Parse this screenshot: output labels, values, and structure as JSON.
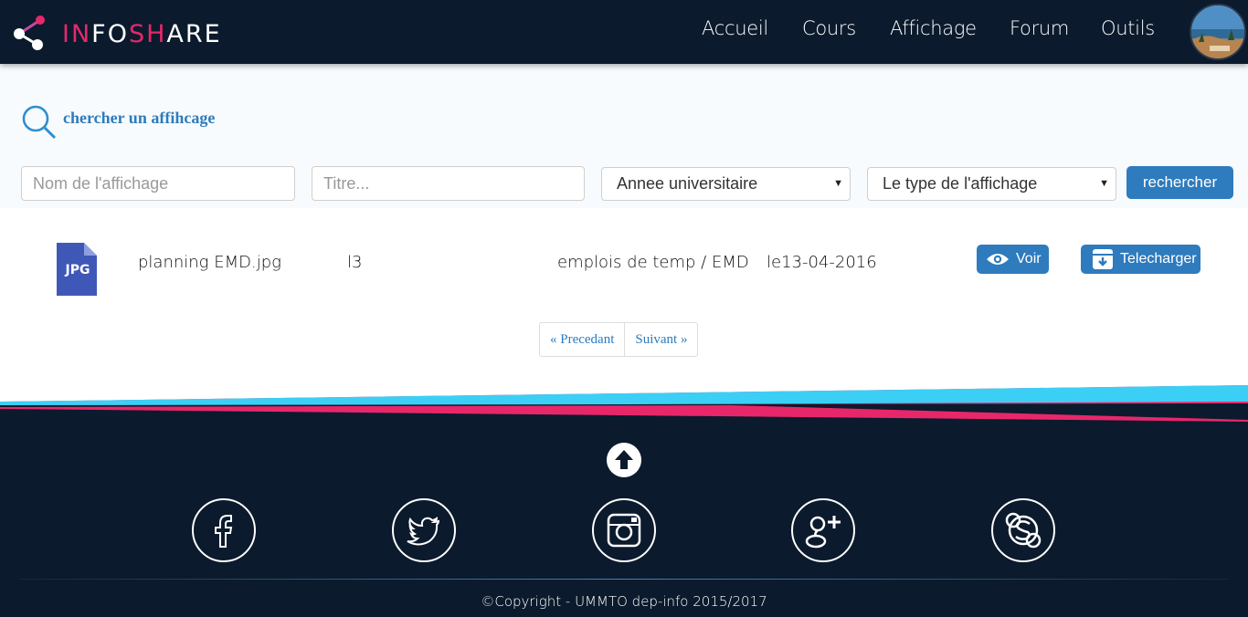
{
  "brand": {
    "prefix": "IN",
    "mid": "FO",
    "sh": "SH",
    "suffix": "ARE"
  },
  "nav": {
    "items": [
      "Accueil",
      "Cours",
      "Affichage",
      "Forum",
      "Outils"
    ]
  },
  "search": {
    "title": "chercher un affihcage",
    "name_placeholder": "Nom de l'affichage",
    "title_placeholder": "Titre...",
    "year_select": "Annee universitaire",
    "type_select": "Le type de l'affichage",
    "button_label": "rechercher"
  },
  "results": [
    {
      "file_type": "JPG",
      "name": "planning EMD.jpg",
      "level": "l3",
      "category": "emplois de temp / EMD",
      "date": "le13-04-2016",
      "view_label": "Voir",
      "download_label": "Telecharger"
    }
  ],
  "pagination": {
    "prev": "« Precedant",
    "next": "Suivant »"
  },
  "footer": {
    "copyright": "©Copyright - UMMTO dep-info 2015/2017",
    "social": [
      "facebook-icon",
      "twitter-icon",
      "instagram-icon",
      "google-plus-icon",
      "skype-icon"
    ]
  },
  "colors": {
    "header_bg": "#0b1a2c",
    "accent_blue": "#2e7bbd",
    "brand_pink": "#e8276b",
    "stripe_cyan": "#3ccff5"
  }
}
